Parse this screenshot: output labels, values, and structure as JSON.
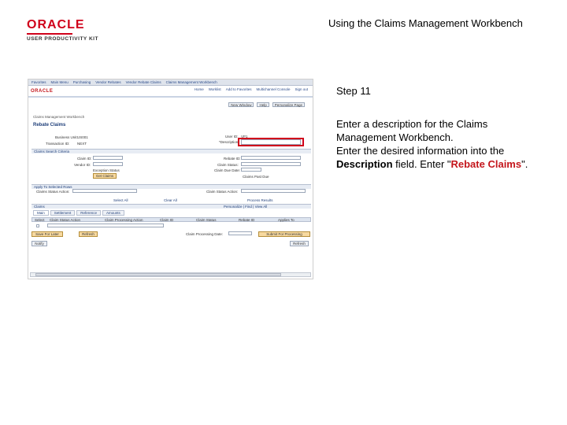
{
  "header": {
    "logo_text": "ORACLE",
    "logo_subtext": "USER PRODUCTIVITY KIT",
    "doc_title": "Using the Claims Management Workbench"
  },
  "screenshot": {
    "nav_items": [
      "Favorites",
      "Main Menu",
      "Purchasing",
      "Vendor Rebates",
      "Vendor Rebate Claims",
      "Claims Management Workbench"
    ],
    "app_logo": "ORACLE",
    "top_links": [
      "Home",
      "Worklist",
      "Add to Favorites",
      "Multichannel Console",
      "Sign out"
    ],
    "toolbar": [
      "New Window",
      "Help",
      "Personalize Page"
    ],
    "breadcrumb": "Claims Management Workbench",
    "page_heading": "Rebate Claims",
    "fields": {
      "business_unit_label": "Business Unit:",
      "business_unit_value": "US001",
      "transaction_id_label": "Transaction ID:",
      "transaction_id_value": "NEXT",
      "user_id_label": "User ID:",
      "user_id_value": "VP1",
      "description_label": "*Description:",
      "description_value": ""
    },
    "sections": {
      "search_criteria": "Claims Search Criteria",
      "apply_to_selected": "Apply To Selected Rows",
      "claims": "Claims"
    },
    "search_fields": [
      "Claim ID:",
      "Vendor ID:",
      "Rebate ID:",
      "Claim Status:",
      "Claim Due Date:"
    ],
    "checkboxes": [
      "Exception Status",
      "Claims Past Due"
    ],
    "buttons": {
      "get_claims": "Get Claims",
      "save_for_later": "Save For Later",
      "refresh": "Refresh",
      "submit": "Submit For Processing",
      "notify": "Notify",
      "refresh_bottom": "Refresh"
    },
    "apply_labels": [
      "Claims Status Action:",
      "Claim Status Action:"
    ],
    "links": [
      "Select All",
      "Clear All",
      "Process Results"
    ],
    "tabs": [
      "Main",
      "Settlement",
      "Reference",
      "Amounts"
    ],
    "grid_controls": "Personalize | Find | View All",
    "grid_columns": [
      "Select",
      "Claim Status Action",
      "Claim Processing Action",
      "Claim ID",
      "Claim Status",
      "Rebate ID",
      "Applies To"
    ],
    "due_label": "Claim Processing Date:"
  },
  "instructions": {
    "step": "Step 11",
    "line1": "Enter a description for the Claims Management Workbench.",
    "line2_prefix": "Enter the desired information into the ",
    "field_name": "Description",
    "line2_mid": " field. Enter \"",
    "entry_value": "Rebate Claims",
    "line2_suffix": "\"."
  }
}
